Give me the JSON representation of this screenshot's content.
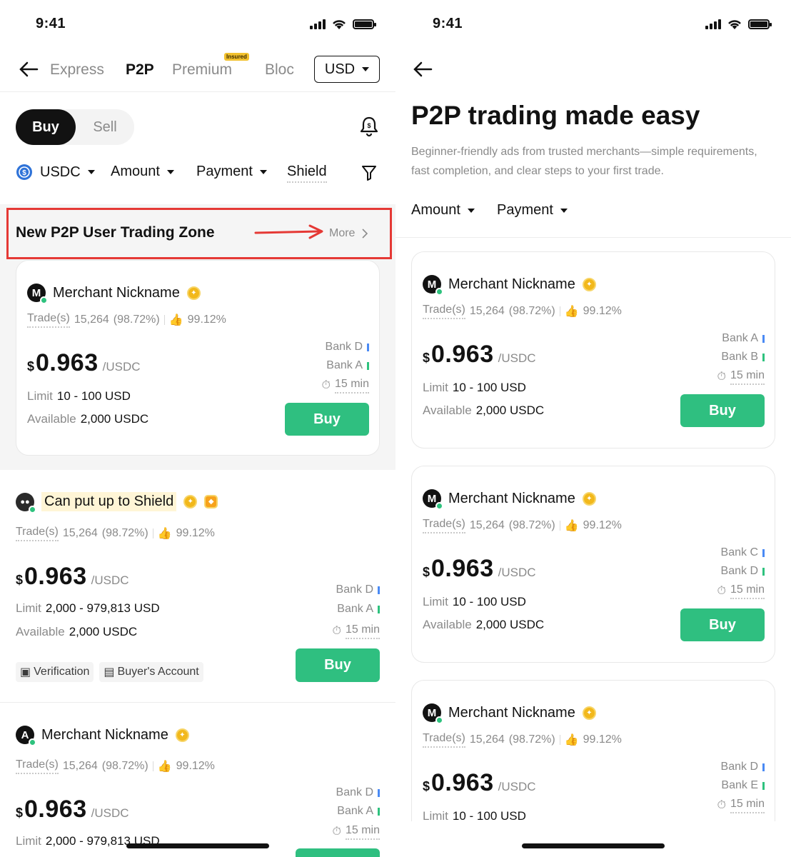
{
  "left": {
    "status_time": "9:41",
    "nav_tabs": [
      "Express",
      "P2P",
      "Premium",
      "Bloc"
    ],
    "insured_badge": "Insured",
    "currency": "USD",
    "trade_toggle": {
      "buy": "Buy",
      "sell": "Sell"
    },
    "filters": {
      "coin": "USDC",
      "amount": "Amount",
      "payment": "Payment",
      "shield": "Shield"
    },
    "zone": {
      "title": "New P2P User Trading Zone",
      "more": "More"
    },
    "zone_card": {
      "avatar": "M",
      "name": "Merchant Nickname",
      "trades_label": "Trade(s)",
      "trades": "15,264",
      "completion": "(98.72%)",
      "positive": "99.12%",
      "currency_sign": "$",
      "price": "0.963",
      "unit": "/USDC",
      "limit_label": "Limit",
      "limit": "10 - 100 USD",
      "available_label": "Available",
      "available": "2,000 USDC",
      "bank1": "Bank D",
      "bank2": "Bank A",
      "time": "15 min",
      "buy": "Buy"
    },
    "shield_card": {
      "name": "Can put up to Shield",
      "trades_label": "Trade(s)",
      "trades": "15,264",
      "completion": "(98.72%)",
      "positive": "99.12%",
      "currency_sign": "$",
      "price": "0.963",
      "unit": "/USDC",
      "limit_label": "Limit",
      "limit": "2,000 - 979,813 USD",
      "available_label": "Available",
      "available": "2,000 USDC",
      "bank1": "Bank D",
      "bank2": "Bank A",
      "time": "15 min",
      "tag1": "Verification",
      "tag2": "Buyer's Account",
      "buy": "Buy"
    },
    "third_card": {
      "avatar": "A",
      "name": "Merchant Nickname",
      "trades_label": "Trade(s)",
      "trades": "15,264",
      "completion": "(98.72%)",
      "positive": "99.12%",
      "currency_sign": "$",
      "price": "0.963",
      "unit": "/USDC",
      "limit_label": "Limit",
      "limit": "2,000 - 979,813 USD",
      "bank1": "Bank D",
      "bank2": "Bank A",
      "time": "15 min"
    }
  },
  "right": {
    "status_time": "9:41",
    "title": "P2P trading made easy",
    "subtitle": "Beginner-friendly ads from trusted merchants—simple requirements, fast completion, and clear steps to your first trade.",
    "filters": {
      "amount": "Amount",
      "payment": "Payment"
    },
    "cards": [
      {
        "avatar": "M",
        "name": "Merchant Nickname",
        "trades_label": "Trade(s)",
        "trades": "15,264",
        "completion": "(98.72%)",
        "positive": "99.12%",
        "currency_sign": "$",
        "price": "0.963",
        "unit": "/USDC",
        "limit_label": "Limit",
        "limit": "10 - 100 USD",
        "available_label": "Available",
        "available": "2,000 USDC",
        "bank1": "Bank A",
        "bank2": "Bank B",
        "time": "15 min",
        "buy": "Buy"
      },
      {
        "avatar": "M",
        "name": "Merchant Nickname",
        "trades_label": "Trade(s)",
        "trades": "15,264",
        "completion": "(98.72%)",
        "positive": "99.12%",
        "currency_sign": "$",
        "price": "0.963",
        "unit": "/USDC",
        "limit_label": "Limit",
        "limit": "10 - 100 USD",
        "available_label": "Available",
        "available": "2,000 USDC",
        "bank1": "Bank C",
        "bank2": "Bank D",
        "time": "15 min",
        "buy": "Buy"
      },
      {
        "avatar": "M",
        "name": "Merchant Nickname",
        "trades_label": "Trade(s)",
        "trades": "15,264",
        "completion": "(98.72%)",
        "positive": "99.12%",
        "currency_sign": "$",
        "price": "0.963",
        "unit": "/USDC",
        "limit_label": "Limit",
        "limit": "10 - 100 USD",
        "bank1": "Bank D",
        "bank2": "Bank E",
        "time": "15 min"
      }
    ]
  },
  "colors": {
    "accent_green": "#2fbf80",
    "highlight_red": "#e53935",
    "badge_gold": "#f2b81b",
    "zone_bg": "#f5f5f5"
  }
}
